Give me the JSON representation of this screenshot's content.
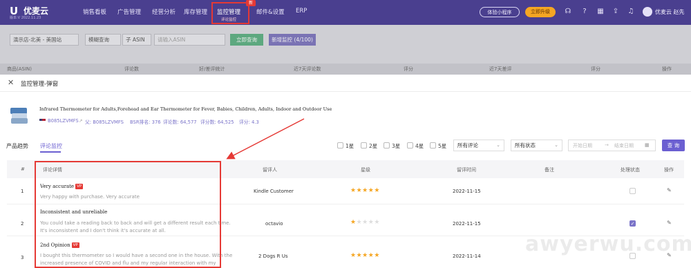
{
  "topnav": {
    "logo_name": "优麦云",
    "logo_sub": "版本:V 2022.11.23",
    "items": [
      "销售看板",
      "广告管理",
      "经营分析",
      "库存管理",
      "监控管理",
      "邮件&设置",
      "ERP"
    ],
    "active_sub": "评论监控",
    "new_badge": "新",
    "mini_program": "体验小程序",
    "upgrade": "立即升级",
    "icons": [
      "headset-icon",
      "help-icon",
      "calendar-icon",
      "export-icon",
      "bell-icon",
      "user-icon"
    ],
    "user": "优麦云 赵先"
  },
  "background": {
    "filters": [
      "演示店-北美 - 美国站",
      "模糊查询",
      "子 ASIN",
      "请输入ASIN"
    ],
    "search_button": "立即查询",
    "add_button": "新增监控 (4/100)",
    "columns": [
      "商品(ASIN)",
      "评论数",
      "好/差评统计",
      "近7天评论数",
      "评分",
      "近7天差评",
      "评分",
      "操作"
    ]
  },
  "modal": {
    "title": "监控管理-弹窗",
    "product": {
      "title": "Infrared Thermometer for Adults,Forehead and Ear Thermometer for Fever, Babies, Children, Adults, Indoor and Outdoor Use",
      "asin": "B085LZVMFS",
      "child_asin": "父: B085LZVMFS",
      "bsr": "BSR排名: 376",
      "reviews": "评论数: 64,577",
      "ratings": "评分数: 64,525",
      "score": "评分: 4.3"
    },
    "tabs": [
      "产品趋势",
      "评论监控"
    ],
    "star_filters": [
      "1星",
      "2星",
      "3星",
      "4星",
      "5星"
    ],
    "review_filter": "所有评论",
    "status_filter": "所有状态",
    "start_date_placeholder": "开始日期",
    "end_date_placeholder": "结束日期",
    "date_separator": "→",
    "query_button": "查 询",
    "table": {
      "columns": [
        "#",
        "评论详情",
        "留评人",
        "星级",
        "留评时间",
        "备注",
        "处理状态",
        "操作"
      ],
      "rows": [
        {
          "index": "1",
          "title": "Very accurate",
          "vp": "VP",
          "body": "Very happy with purchase. Very accurate",
          "reviewer": "Kindle Customer",
          "stars": 5,
          "date": "2022-11-15",
          "handled": false
        },
        {
          "index": "2",
          "title": "Inconsistent and unreliable",
          "vp": "",
          "body": "You could take a reading back to back and will get a different result each time. It's inconsistent and I don't think it's accurate at all.",
          "reviewer": "octavio",
          "stars": 1,
          "date": "2022-11-15",
          "handled": true
        },
        {
          "index": "3",
          "title": "2nd Opinion",
          "vp": "VP",
          "body": "I bought this thermometer so I would have a second one in the house. With the increased presence of COVID and flu and my regular interaction with my",
          "reviewer": "2 Dogs R Us",
          "stars": 5,
          "date": "2022-11-14",
          "handled": false
        }
      ]
    }
  },
  "watermark": "awyerwu.com",
  "colors": {
    "nav_bg": "#4a3f8f",
    "accent": "#6b5fd1",
    "highlight": "#e53935",
    "star": "#f5a623"
  }
}
